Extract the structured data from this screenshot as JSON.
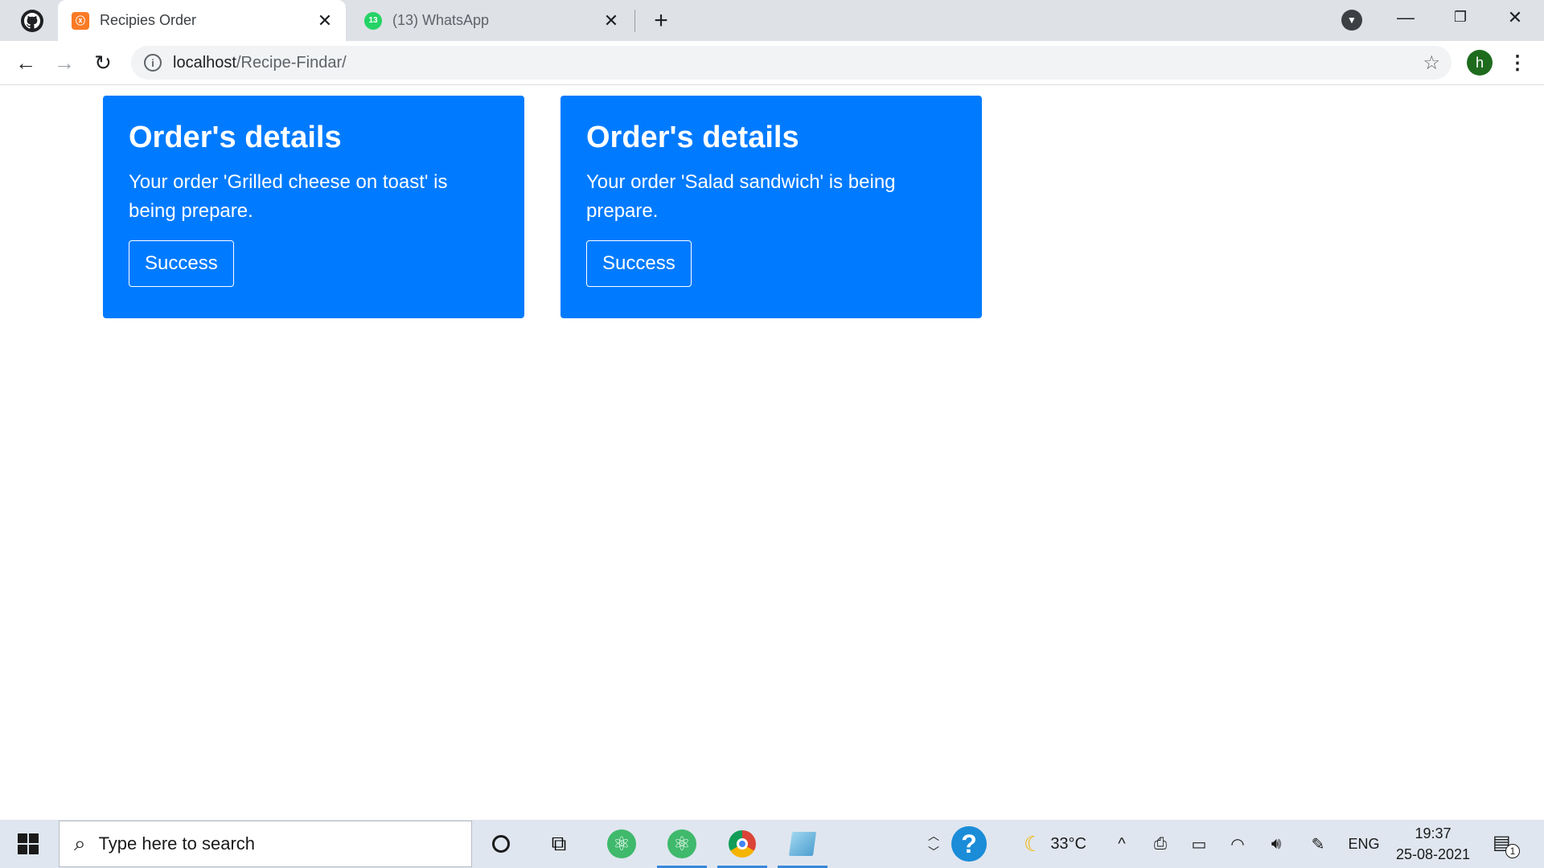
{
  "browser": {
    "tabs": [
      {
        "title": "Recipies Order",
        "favicon": "xampp-icon",
        "active": true
      },
      {
        "title": "(13) WhatsApp",
        "favicon": "whatsapp-icon",
        "badge": "13",
        "active": false
      }
    ],
    "url_host": "localhost",
    "url_path": "/Recipe-Findar/",
    "profile_initial": "h"
  },
  "orders": [
    {
      "heading": "Order's details",
      "text": "Your order 'Grilled cheese on toast' is being prepare.",
      "button": "Success"
    },
    {
      "heading": "Order's details",
      "text": "Your order 'Salad sandwich' is being prepare.",
      "button": "Success"
    }
  ],
  "colors": {
    "card_bg": "#007bff",
    "tabstrip_bg": "#dee1e6",
    "taskbar_bg": "#dfe6ef"
  },
  "taskbar": {
    "search_placeholder": "Type here to search",
    "weather": "33°C",
    "language": "ENG",
    "time": "19:37",
    "date": "25-08-2021",
    "notification_count": "1"
  }
}
